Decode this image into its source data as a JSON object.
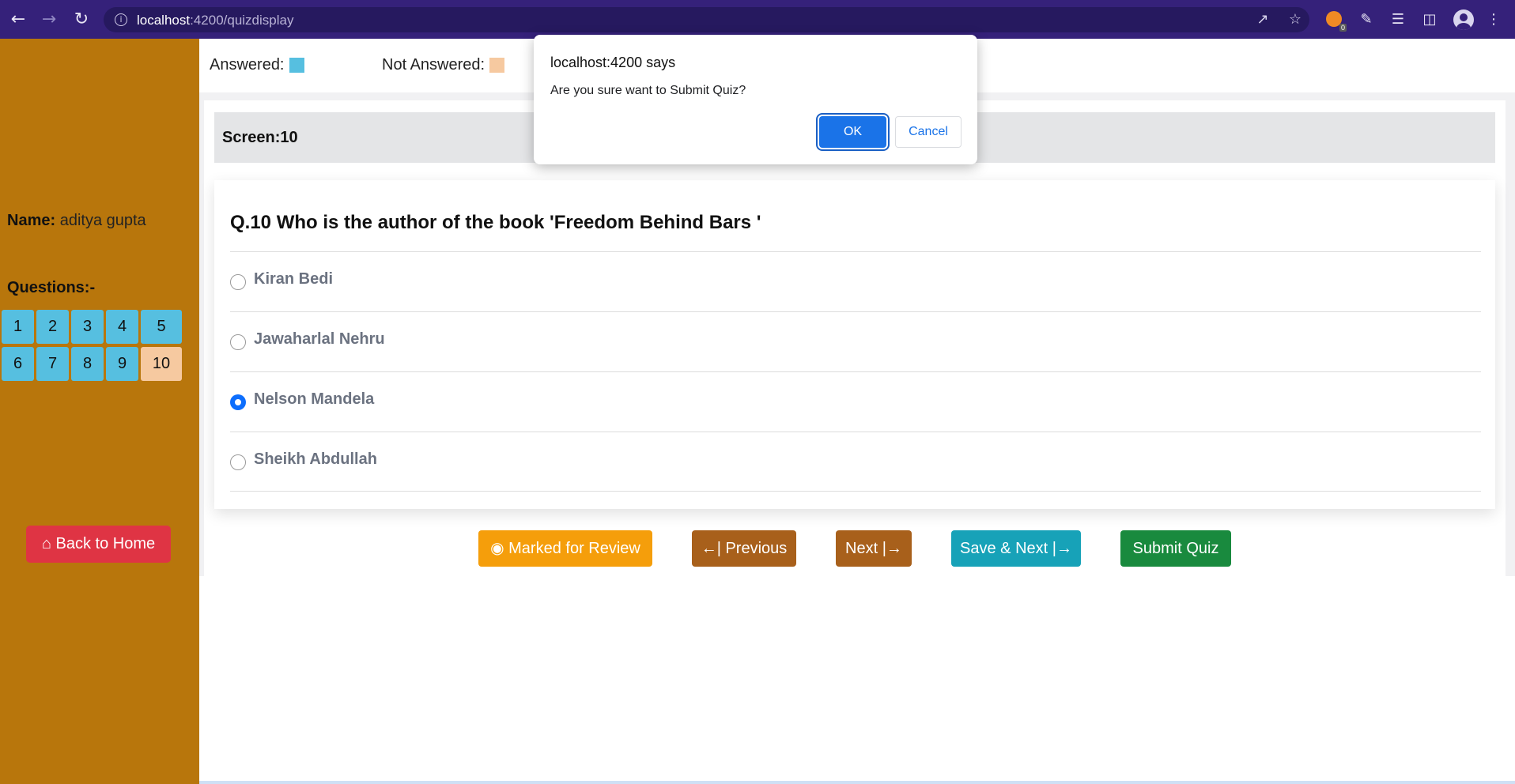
{
  "browser": {
    "url_host": "localhost",
    "url_path": ":4200/quizdisplay",
    "extension_badge_count": "0"
  },
  "sidebar": {
    "name_label": "Name:",
    "name_value": "aditya gupta",
    "questions_title": "Questions:-",
    "question_numbers": [
      "1",
      "2",
      "3",
      "4",
      "5",
      "6",
      "7",
      "8",
      "9",
      "10"
    ],
    "current_question": "10",
    "back_home_label": "Back to Home"
  },
  "legend": {
    "answered_label": "Answered:",
    "not_answered_label": "Not Answered:",
    "answered_color": "#56bfe0",
    "not_answered_color": "#f6c9a0"
  },
  "screen": {
    "label": "Screen:10"
  },
  "question": {
    "title": "Q.10 Who is the author of the book 'Freedom Behind Bars '",
    "options": [
      "Kiran Bedi",
      "Jawaharlal Nehru",
      "Nelson Mandela",
      "Sheikh Abdullah"
    ],
    "selected_option": "Nelson Mandela"
  },
  "actions": {
    "review_label": "Marked for Review",
    "previous_label": "Previous",
    "next_label": "Next",
    "save_next_label": "Save & Next",
    "submit_label": "Submit Quiz"
  },
  "dialog": {
    "title": "localhost:4200 says",
    "message": "Are you sure want to Submit Quiz?",
    "ok_label": "OK",
    "cancel_label": "Cancel"
  },
  "icons": {
    "back": "arrow-left-icon",
    "forward": "arrow-right-icon",
    "reload": "reload-icon",
    "site_info": "info-icon",
    "share": "share-icon",
    "bookmark": "star-icon",
    "extensions": "puzzle-icon",
    "reading_list": "reading-list-icon",
    "side_panel": "side-panel-icon",
    "profile": "avatar-icon",
    "menu": "kebab-menu-icon",
    "review": "eye-icon",
    "home": "home-icon"
  },
  "colors": {
    "browser_bar": "#35217a",
    "sidebar": "#b8760c",
    "review_button": "#f59e0b",
    "nav_buttons": "#a8601b",
    "save_next_button": "#17a2b8",
    "submit_button": "#198a3e",
    "back_home_button": "#df3444",
    "radio_selected": "#0d6efd",
    "dialog_ok": "#1a73e8"
  }
}
